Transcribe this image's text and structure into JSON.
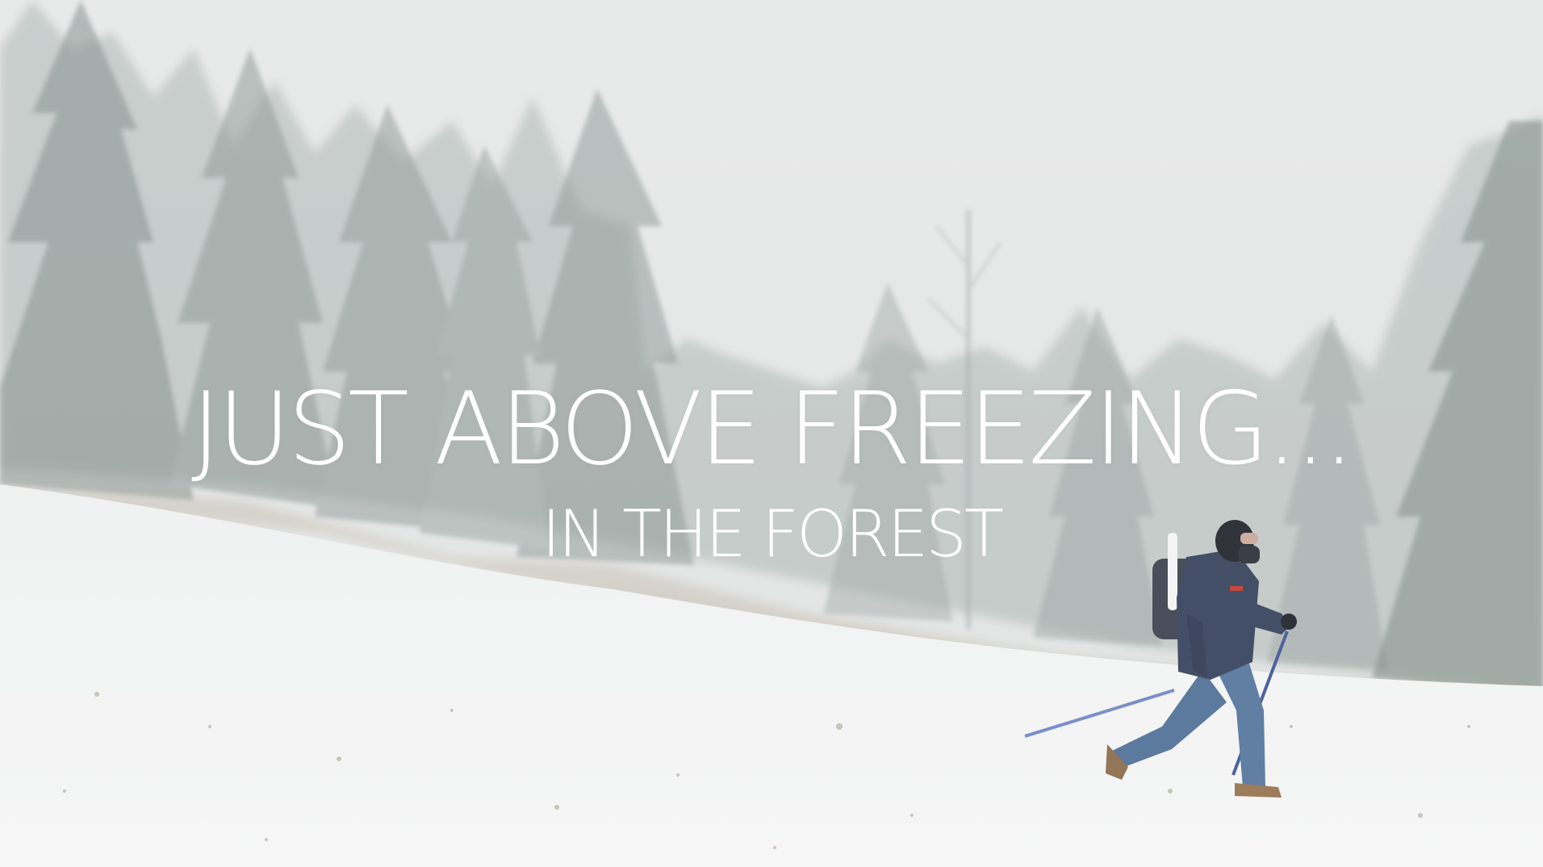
{
  "photo": {
    "description_icon": "hiker-in-foggy-snow-forest-photo",
    "colors": {
      "fog": "#e4e7e7",
      "snow": "#f4f5f5",
      "forest": "#8f9a97",
      "jacket": "#34405a",
      "pants": "#4f6e96"
    }
  },
  "overlay": {
    "title": "JUST ABOVE FREEZING...",
    "subtitle": "IN THE FOREST"
  }
}
